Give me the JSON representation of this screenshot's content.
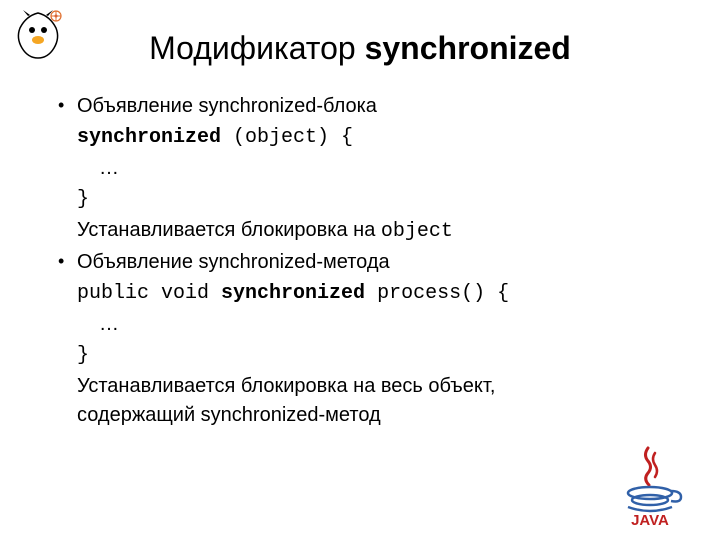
{
  "title_prefix": "Модификатор ",
  "title_bold": "synchronized",
  "bullet1": "Объявление synchronized-блока",
  "code1_bold": "synchronized",
  "code1_rest": " (object) {",
  "ellipsis1": "…",
  "brace_close1": "}",
  "lock1_prefix": "Устанавливается блокировка на ",
  "lock1_code": "object",
  "bullet2": "Объявление synchronized-метода",
  "code2_prefix": "public void ",
  "code2_bold": "synchronized",
  "code2_suffix": " process() {",
  "ellipsis2": "…",
  "brace_close2": "}",
  "lock2": "Устанавливается блокировка на весь объект, содержащий synchronized-метод",
  "java_label": "JAVA"
}
